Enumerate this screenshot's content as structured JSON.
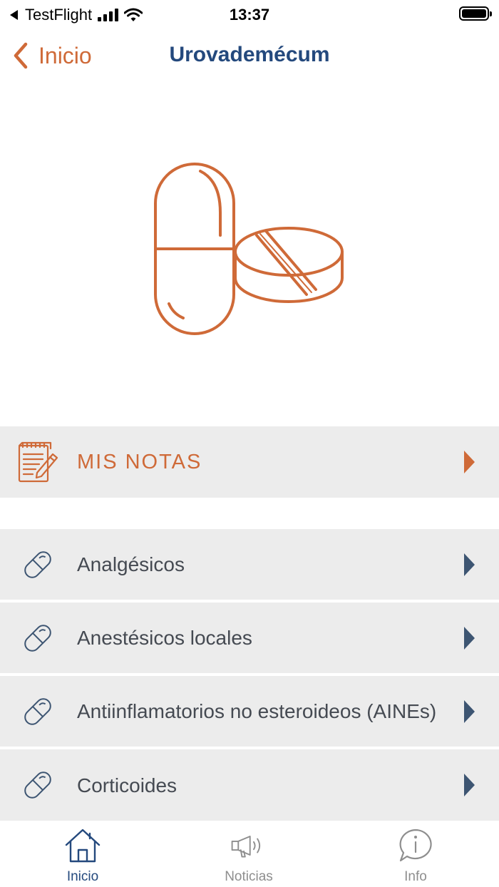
{
  "status_bar": {
    "carrier": "TestFlight",
    "time": "13:37"
  },
  "nav": {
    "back_label": "Inicio",
    "title": "Urovademécum"
  },
  "notes_row": {
    "label": "MIS NOTAS",
    "icon": "notepad-pencil-icon"
  },
  "categories": [
    {
      "label": "Analgésicos",
      "icon": "pill-icon"
    },
    {
      "label": "Anestésicos locales",
      "icon": "pill-icon"
    },
    {
      "label": "Antiinflamatorios no esteroideos (AINEs)",
      "icon": "pill-icon"
    },
    {
      "label": "Corticoides",
      "icon": "pill-icon"
    }
  ],
  "tabs": [
    {
      "label": "Inicio",
      "icon": "home-icon",
      "active": true
    },
    {
      "label": "Noticias",
      "icon": "megaphone-icon",
      "active": false
    },
    {
      "label": "Info",
      "icon": "info-bubble-icon",
      "active": false
    }
  ],
  "colors": {
    "accent_orange": "#cf6a38",
    "brand_blue": "#24497d",
    "row_background": "#ececec",
    "arrow_blue": "#3d5572"
  }
}
